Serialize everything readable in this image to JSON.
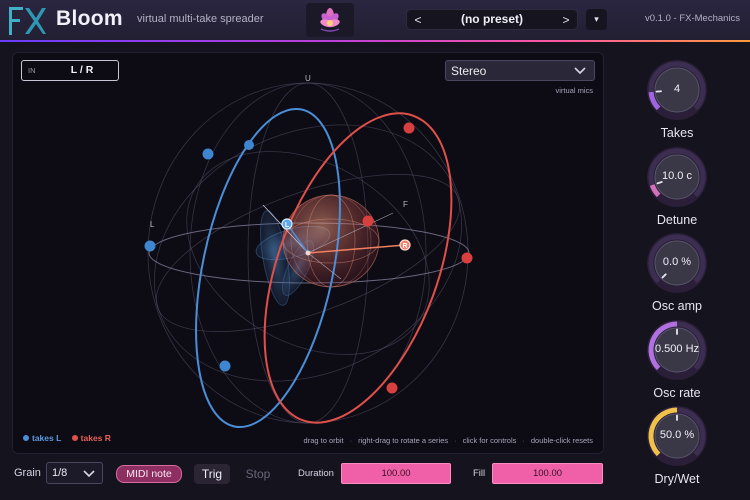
{
  "header": {
    "title": "Bloom",
    "subtitle": "virtual multi-take spreader",
    "preset_prev": "<",
    "preset_name": "(no preset)",
    "preset_next": ">",
    "preset_menu": "▾",
    "version": "v0.1.0  -  FX-Mechanics"
  },
  "viz": {
    "io_label": "IN",
    "io_value": "L / R",
    "mic_mode": "Stereo",
    "mic_caption": "virtual mics",
    "axis_up": "U",
    "axis_left": "L",
    "axis_front": "F",
    "marker_left": "L",
    "marker_right": "R",
    "legend_left": "takes L",
    "legend_right": "takes R",
    "hint_drag": "drag to orbit",
    "hint_right_drag": "right-drag to rotate a series",
    "hint_click": "click for controls",
    "hint_double_click": "double-click resets",
    "colors": {
      "left": "#4a8ed8",
      "right": "#e0504a",
      "accent": "#f060a8"
    }
  },
  "knobs": [
    {
      "label": "Takes",
      "value": "4",
      "level": 0.15,
      "color": "#a064e0"
    },
    {
      "label": "Detune",
      "value": "10.0 c",
      "level": 0.1,
      "color": "#d070b8"
    },
    {
      "label": "Osc amp",
      "value": "0.0 %",
      "level": 0.0,
      "color": "#d070b8"
    },
    {
      "label": "Osc rate",
      "value": "0.500 Hz",
      "level": 0.5,
      "color": "#b070e0"
    },
    {
      "label": "Dry/Wet",
      "value": "50.0 %",
      "level": 0.5,
      "color": "#f0c048"
    }
  ],
  "bottom": {
    "grain_label": "Grain",
    "grain_value": "1/8",
    "midi_button": "MIDI note",
    "trig_button": "Trig",
    "stop_button": "Stop",
    "duration_label": "Duration",
    "duration_value": "100.00",
    "fill_label": "Fill",
    "fill_value": "100.00"
  }
}
